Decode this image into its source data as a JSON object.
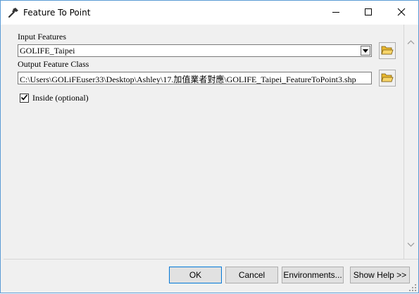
{
  "window": {
    "title": "Feature To Point",
    "title_icon": "hammer-icon",
    "controls": {
      "minimize": "minimize-icon",
      "maximize": "maximize-icon",
      "close": "close-icon"
    }
  },
  "form": {
    "input_features": {
      "label": "Input Features",
      "value": "GOLIFE_Taipei"
    },
    "output_feature_class": {
      "label": "Output Feature Class",
      "value": "C:\\Users\\GOLiFEuser33\\Desktop\\Ashley\\17.加值業者對應\\GOLIFE_Taipei_FeatureToPoint3.shp"
    },
    "inside": {
      "label": "Inside (optional)",
      "checked": true
    }
  },
  "buttons": {
    "ok": "OK",
    "cancel": "Cancel",
    "environments": "Environments...",
    "show_help": "Show Help >>"
  },
  "colors": {
    "window_border": "#5b9bd5",
    "background": "#f0f0f0",
    "button_face": "#e1e1e1",
    "default_button_border": "#0078d7",
    "folder_yellow": "#e8b830"
  }
}
